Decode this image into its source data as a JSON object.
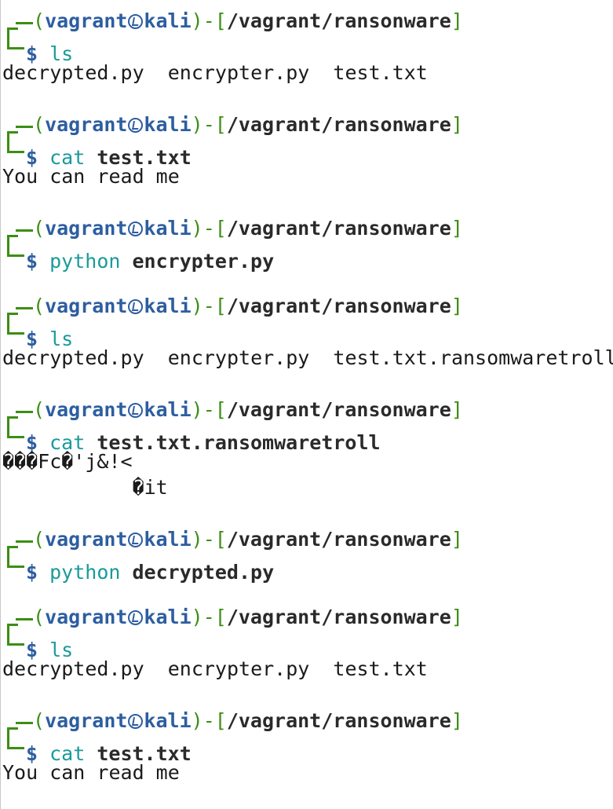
{
  "prompt": {
    "user": "vagrant",
    "host": "kali",
    "path": "/vagrant/ransonware",
    "open_paren": "(",
    "close_paren": ")",
    "sep": "-",
    "open_bracket": "[",
    "close_bracket": "]",
    "dollar": "$"
  },
  "blocks": [
    {
      "cmd": "ls",
      "arg": "",
      "output": [
        "decrypted.py  encrypter.py  test.txt"
      ]
    },
    {
      "cmd": "cat",
      "arg": "test.txt",
      "output": [
        "You can read me"
      ]
    },
    {
      "cmd": "python",
      "arg": "encrypter.py",
      "output": []
    },
    {
      "cmd": "ls",
      "arg": "",
      "output": [
        "decrypted.py  encrypter.py  test.txt.ransomwaretroll"
      ]
    },
    {
      "cmd": "cat",
      "arg": "test.txt.ransomwaretroll",
      "output": [
        "���Fc�'j&!<",
        "           �it"
      ]
    },
    {
      "cmd": "python",
      "arg": "decrypted.py",
      "output": []
    },
    {
      "cmd": "ls",
      "arg": "",
      "output": [
        "decrypted.py  encrypter.py  test.txt"
      ]
    },
    {
      "cmd": "cat",
      "arg": "test.txt",
      "output": [
        "You can read me"
      ]
    }
  ],
  "colors": {
    "prompt_bracket": "#3c8e14",
    "user_host": "#2d5ea0",
    "command": "#1a9a9a",
    "text": "#1a1a1a"
  },
  "icons": {
    "host_separator": "kali-logo-icon"
  }
}
